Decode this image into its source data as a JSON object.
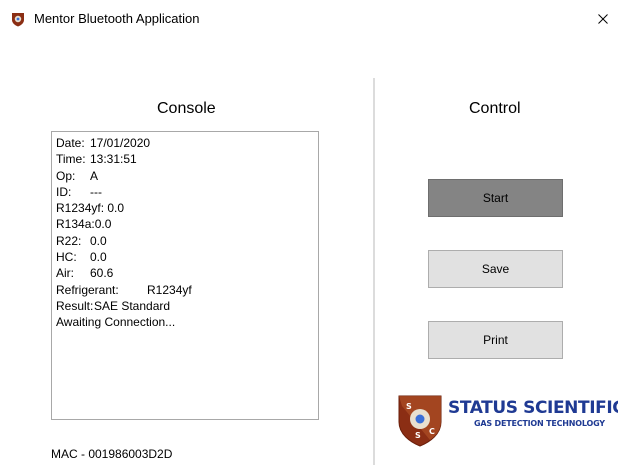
{
  "window": {
    "title": "Mentor Bluetooth Application",
    "app_icon": "mentor-app-icon",
    "close_icon": "close-icon"
  },
  "console": {
    "header": "Console",
    "lines": [
      {
        "label": "Date:",
        "value": "17/01/2020"
      },
      {
        "label": "Time:",
        "value": "13:31:51"
      },
      {
        "label": "Op:",
        "value": "A"
      },
      {
        "label": "ID:",
        "value": "---"
      },
      {
        "label": "R1234yf:",
        "value": "0.0"
      },
      {
        "label": "R134a:",
        "value": "0.0"
      },
      {
        "label": "R22:",
        "value": "0.0"
      },
      {
        "label": "HC:",
        "value": "0.0"
      },
      {
        "label": "Air:",
        "value": "60.6"
      },
      {
        "label": "Refrigerant:",
        "value": "R1234yf"
      },
      {
        "label": "Result:",
        "value": "SAE Standard"
      },
      {
        "label": "Awaiting Connection...",
        "value": ""
      }
    ],
    "mac": "MAC - 001986003D2D"
  },
  "control": {
    "header": "Control",
    "start_label": "Start",
    "save_label": "Save",
    "print_label": "Print"
  },
  "logo": {
    "badge": "S.S.C",
    "title": "STATUS SCIENTIFIC",
    "subtitle": "GAS DETECTION TECHNOLOGY",
    "colors": {
      "primary": "#1f3a93",
      "badge": "#8b2e14"
    }
  }
}
